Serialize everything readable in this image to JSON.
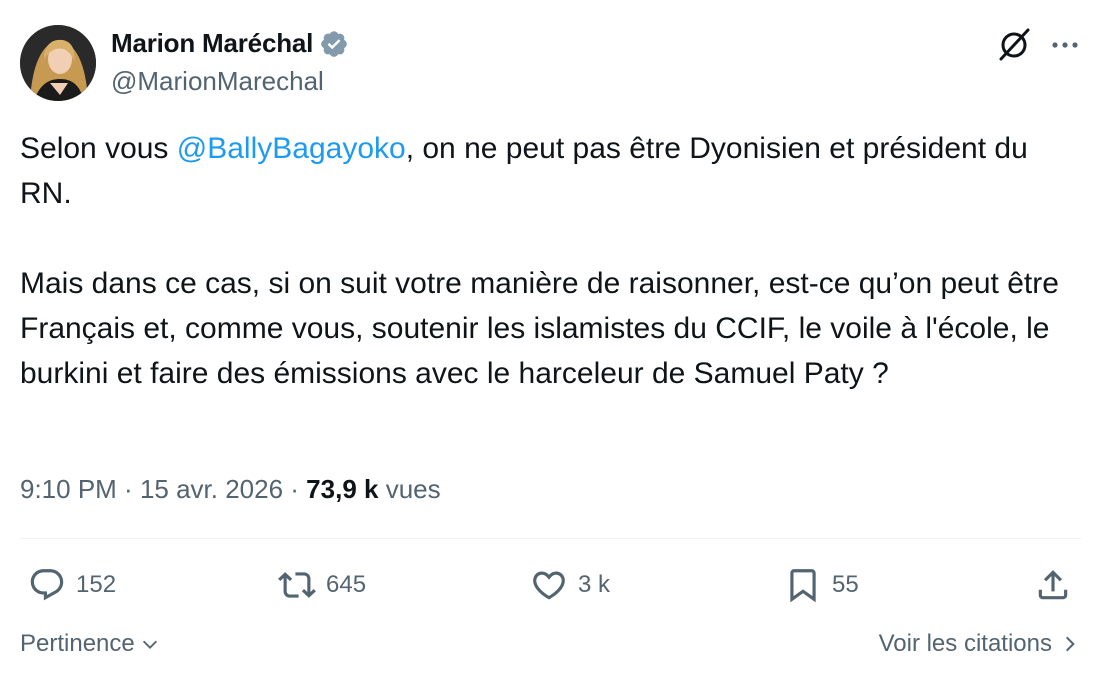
{
  "author": {
    "display_name": "Marion Maréchal",
    "handle": "@MarionMarechal",
    "verified": true,
    "verified_color": "#829aab"
  },
  "tweet": {
    "line1_before": "Selon vous ",
    "mention": "@BallyBagayoko",
    "line1_after": ", on ne peut pas être Dyonisien et président du RN.",
    "paragraph2": "Mais dans ce cas, si on suit votre manière de raisonner, est-ce qu’on peut être Français et, comme vous, soutenir les islamistes du CCIF, le voile à l'école, le burkini et faire des émissions avec le harceleur de Samuel Paty ?"
  },
  "meta": {
    "time": "9:10 PM",
    "separator": " · ",
    "date": "15 avr. 2026",
    "separator2": " · ",
    "views_count": "73,9 k",
    "views_label": " vues"
  },
  "actions": {
    "replies": "152",
    "reposts": "645",
    "likes": "3 k",
    "bookmarks": "55"
  },
  "footer": {
    "sort_label": "Pertinence",
    "quotes_label": "Voir les citations"
  },
  "colors": {
    "accent": "#1d9bf0",
    "text": "#0f1419",
    "secondary": "#536471"
  }
}
